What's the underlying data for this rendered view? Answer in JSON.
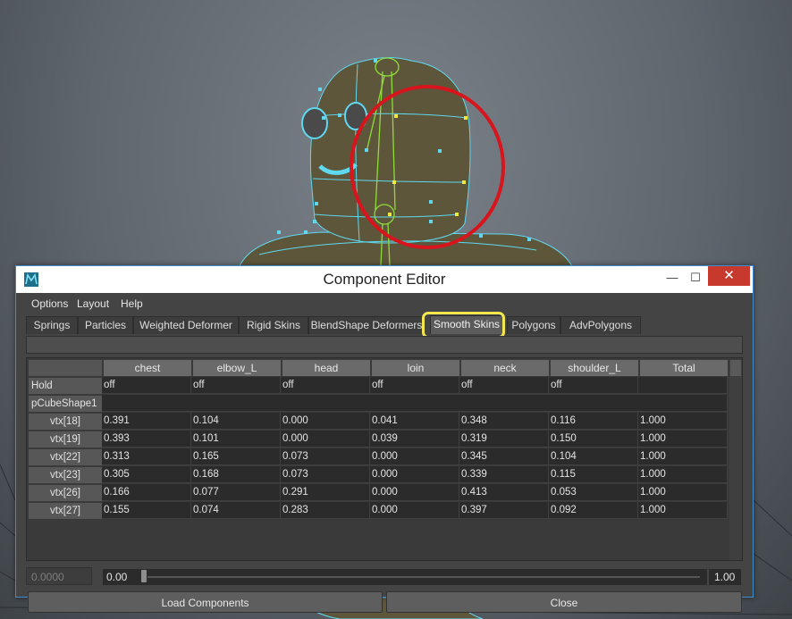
{
  "window": {
    "title": "Component Editor",
    "minimize_glyph": "—",
    "maximize_glyph": "☐",
    "close_glyph": "✕"
  },
  "menu": [
    "Options",
    "Layout",
    "Help"
  ],
  "tabs": [
    "Springs",
    "Particles",
    "Weighted Deformer",
    "Rigid Skins",
    "BlendShape Deformers",
    "Smooth Skins",
    "Polygons",
    "AdvPolygons"
  ],
  "active_tab": "Smooth Skins",
  "highlight_color": "#f3e74f",
  "table": {
    "columns": [
      "chest",
      "elbow_L",
      "head",
      "loin",
      "neck",
      "shoulder_L",
      "Total"
    ],
    "hold": {
      "label": "Hold",
      "values": [
        "off",
        "off",
        "off",
        "off",
        "off",
        "off",
        ""
      ]
    },
    "shape": {
      "label": "pCubeShape1"
    },
    "rows": [
      {
        "label": "vtx[18]",
        "values": [
          "0.391",
          "0.104",
          "0.000",
          "0.041",
          "0.348",
          "0.116",
          "1.000"
        ]
      },
      {
        "label": "vtx[19]",
        "values": [
          "0.393",
          "0.101",
          "0.000",
          "0.039",
          "0.319",
          "0.150",
          "1.000"
        ]
      },
      {
        "label": "vtx[22]",
        "values": [
          "0.313",
          "0.165",
          "0.073",
          "0.000",
          "0.345",
          "0.104",
          "1.000"
        ]
      },
      {
        "label": "vtx[23]",
        "values": [
          "0.305",
          "0.168",
          "0.073",
          "0.000",
          "0.339",
          "0.115",
          "1.000"
        ]
      },
      {
        "label": "vtx[26]",
        "values": [
          "0.166",
          "0.077",
          "0.291",
          "0.000",
          "0.413",
          "0.053",
          "1.000"
        ]
      },
      {
        "label": "vtx[27]",
        "values": [
          "0.155",
          "0.074",
          "0.283",
          "0.000",
          "0.397",
          "0.092",
          "1.000"
        ]
      }
    ]
  },
  "value_field": "0.0000",
  "slider": {
    "min_label": "0.00",
    "max_label": "1.00",
    "value": 0
  },
  "buttons": {
    "load": "Load Components",
    "close": "Close"
  },
  "viewport": {
    "mesh_color": "#5e563a",
    "wire_color": "#5fd8f0",
    "joint_color": "#8edc3c",
    "annotation_circle_color": "#d8141c"
  }
}
